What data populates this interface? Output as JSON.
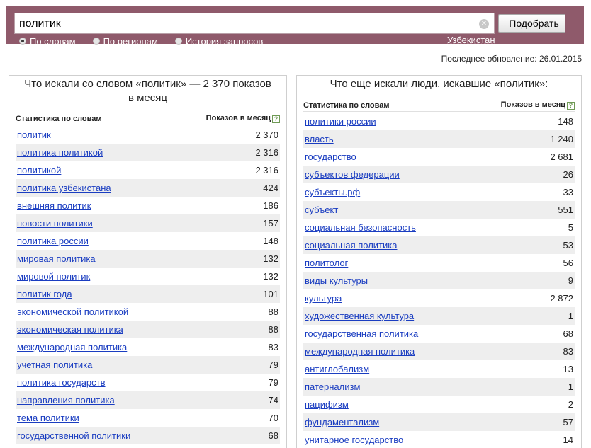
{
  "search": {
    "query": "политик",
    "clear_icon": "✕",
    "submit_label": "Подобрать"
  },
  "modes": [
    {
      "label": "По словам",
      "checked": true
    },
    {
      "label": "По регионам",
      "checked": false
    },
    {
      "label": "История запросов",
      "checked": false
    }
  ],
  "region": "Узбекистан",
  "updated": "Последнее обновление: 26.01.2015",
  "left_panel": {
    "title": "Что искали со словом «политик» — 2 370 показов в месяц",
    "col_words": "Статистика по словам",
    "col_count": "Показов в месяц",
    "help": "?",
    "rows": [
      {
        "phrase": "политик",
        "count": "2 370"
      },
      {
        "phrase": "политика политикой",
        "count": "2 316"
      },
      {
        "phrase": "политикой",
        "count": "2 316"
      },
      {
        "phrase": "политика узбекистана",
        "count": "424"
      },
      {
        "phrase": "внешняя политик",
        "count": "186"
      },
      {
        "phrase": "новости политики",
        "count": "157"
      },
      {
        "phrase": "политика россии",
        "count": "148"
      },
      {
        "phrase": "мировая политика",
        "count": "132"
      },
      {
        "phrase": "мировой политик",
        "count": "132"
      },
      {
        "phrase": "политик года",
        "count": "101"
      },
      {
        "phrase": "экономической политикой",
        "count": "88"
      },
      {
        "phrase": "экономическая политика",
        "count": "88"
      },
      {
        "phrase": "международная политика",
        "count": "83"
      },
      {
        "phrase": "учетная политика",
        "count": "79"
      },
      {
        "phrase": "политика государств",
        "count": "79"
      },
      {
        "phrase": "направления политика",
        "count": "74"
      },
      {
        "phrase": "тема политики",
        "count": "70"
      },
      {
        "phrase": "государственной политики",
        "count": "68"
      }
    ]
  },
  "right_panel": {
    "title": "Что еще искали люди, искавшие «политик»:",
    "col_words": "Статистика по словам",
    "col_count": "Показов в месяц",
    "help": "?",
    "rows": [
      {
        "phrase": "политики россии",
        "count": "148"
      },
      {
        "phrase": "власть",
        "count": "1 240"
      },
      {
        "phrase": "государство",
        "count": "2 681"
      },
      {
        "phrase": "субъектов федерации",
        "count": "26"
      },
      {
        "phrase": "субъекты.рф",
        "count": "33"
      },
      {
        "phrase": "субъект",
        "count": "551"
      },
      {
        "phrase": "социальная безопасность",
        "count": "5"
      },
      {
        "phrase": "социальная политика",
        "count": "53"
      },
      {
        "phrase": "политолог",
        "count": "56"
      },
      {
        "phrase": "виды культуры",
        "count": "9"
      },
      {
        "phrase": "культура",
        "count": "2 872"
      },
      {
        "phrase": "художественная культура",
        "count": "1"
      },
      {
        "phrase": "государственная политика",
        "count": "68"
      },
      {
        "phrase": "международная политика",
        "count": "83"
      },
      {
        "phrase": "антиглобализм",
        "count": "13"
      },
      {
        "phrase": "патернализм",
        "count": "1"
      },
      {
        "phrase": "пацифизм",
        "count": "2"
      },
      {
        "phrase": "фундаментализм",
        "count": "57"
      },
      {
        "phrase": "унитарное государство",
        "count": "14"
      }
    ]
  }
}
